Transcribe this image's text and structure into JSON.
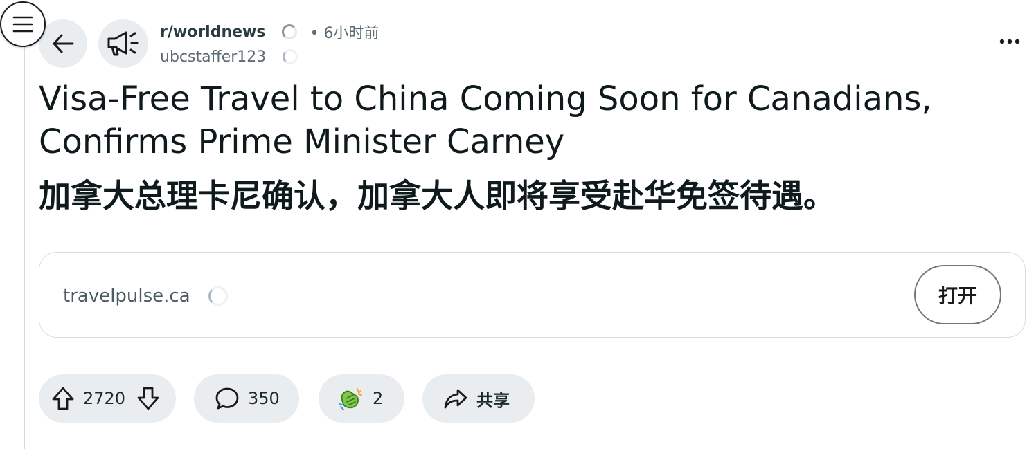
{
  "header": {
    "subreddit": "r/worldnews",
    "time": "• 6小时前",
    "username": "ubcstaffer123"
  },
  "post": {
    "title_en": "Visa-Free Travel to China Coming Soon for Canadians, Confirms Prime Minister Carney",
    "title_zh": "加拿大总理卡尼确认，加拿大人即将享受赴华免签待遇。"
  },
  "link_card": {
    "domain": "travelpulse.ca",
    "open_label": "打开"
  },
  "actions": {
    "votes": "2720",
    "comments": "350",
    "awards": "2",
    "share_label": "共享"
  },
  "icons": [
    "menu-icon",
    "back-arrow-icon",
    "megaphone-icon",
    "loading-spinner-icon",
    "more-options-icon",
    "upvote-icon",
    "downvote-icon",
    "comment-icon",
    "award-icon",
    "share-icon"
  ],
  "colors": {
    "pill_bg": "#eaedef",
    "text": "#0f1a1c",
    "muted": "#5c6c74"
  }
}
